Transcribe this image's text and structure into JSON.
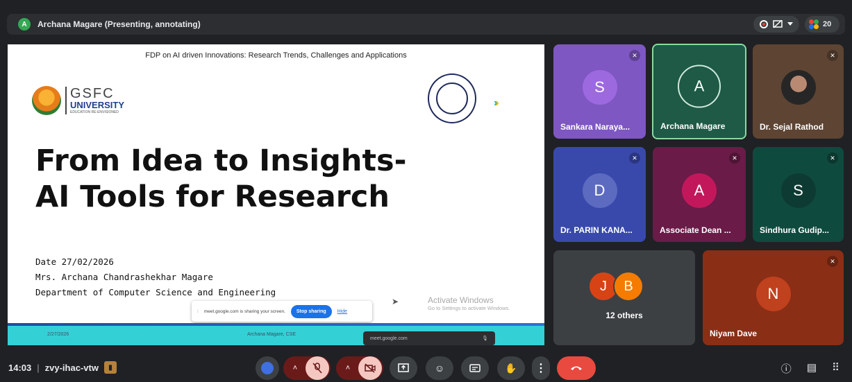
{
  "header": {
    "presenter_initial": "A",
    "presenter_label": "Archana Magare (Presenting, annotating)",
    "participant_count": "20"
  },
  "slide": {
    "header": "FDP on AI driven Innovations: Research Trends, Challenges and Applications",
    "logo_name": "GSFC",
    "logo_univ": "UNIVERSITY",
    "logo_tag": "EDUCATION RE-ENVISIONED",
    "title_line1": "From Idea to Insights-",
    "title_line2": "AI Tools for Research",
    "date": "Date 27/02/2026",
    "author": "Mrs. Archana Chandrashekhar Magare",
    "department": "Department of Computer Science and Engineering",
    "footer_date": "2/27/2026",
    "footer_name": "Archana Magare, CSE"
  },
  "share_bar": {
    "message": "meet.google.com is sharing your screen.",
    "stop_label": "Stop sharing",
    "hide_label": "Hide"
  },
  "watermark": {
    "title": "Activate Windows",
    "subtitle": "Go to Settings to activate Windows."
  },
  "mini_popup": {
    "label": "meet.google.com"
  },
  "participants": [
    {
      "initial": "S",
      "name": "Sankara Naraya...",
      "bg": "#7e57c2",
      "avatar": "#9c6ade",
      "muted": true
    },
    {
      "initial": "A",
      "name": "Archana Magare",
      "bg": "#1e5a46",
      "avatar": "#1e5a46",
      "muted": false
    },
    {
      "initial": "",
      "name": "Dr. Sejal Rathod",
      "bg": "#5d4433",
      "avatar": "#3b3b3b",
      "muted": true
    },
    {
      "initial": "D",
      "name": "Dr. PARIN KANA...",
      "bg": "#3949ab",
      "avatar": "#5c6bc0",
      "muted": true
    },
    {
      "initial": "A",
      "name": "Associate Dean ...",
      "bg": "#6a1b48",
      "avatar": "#c2185b",
      "muted": true
    },
    {
      "initial": "S",
      "name": "Sindhura Gudip...",
      "bg": "#0f4a3f",
      "avatar": "#0d3b33",
      "muted": true
    },
    {
      "initial": "N",
      "name": "Niyam Dave",
      "bg": "#8a2e16",
      "avatar": "#c0411d",
      "muted": true
    }
  ],
  "others": {
    "initials": [
      "J",
      "B"
    ],
    "label": "12 others"
  },
  "footer": {
    "time": "14:03",
    "meeting_code": "zvy-ihac-vtw"
  },
  "colors": {
    "end_call": "#e84a3f",
    "muted_control": "#f5c7c1",
    "muted_tile_chevron": "#6b1a1a"
  }
}
